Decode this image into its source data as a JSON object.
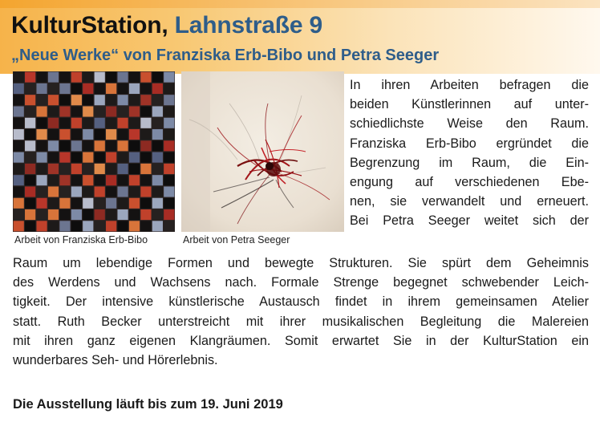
{
  "header": {
    "title_bold": "KulturStation,",
    "title_place": "Lahnstraße 9",
    "subtitle": "„Neue Werke“ von Franziska Erb-Bibo und Petra Seeger"
  },
  "images": [
    {
      "caption": "Arbeit von Franziska Erb-Bibo"
    },
    {
      "caption": "Arbeit von Petra Seeger"
    }
  ],
  "body": {
    "column_lines": [
      "In ihren Arbeiten befragen die",
      "beiden Künstlerinnen auf unter-",
      "schiedlichste Weise den Raum.",
      "Franziska Erb-Bibo ergründet die",
      "Begrenzung im Raum, die Ein-",
      "engung auf verschiedenen Ebe-",
      "nen, sie verwandelt und erneuert.",
      "Bei Petra Seeger weitet sich der"
    ],
    "full_lines": [
      "Raum um lebendige Formen und bewegte Strukturen. Sie spürt dem Geheimnis",
      "des Werdens und Wachsens nach. Formale Strenge begegnet schwebender Leich-",
      "tigkeit. Der intensive künstlerische Austausch findet in ihrem gemeinsamen Atelier",
      "statt. Ruth Becker unterstreicht mit ihrer musikalischen Begleitung die Malereien",
      "mit ihren ganz eigenen Klangräumen. Somit erwartet Sie in der KulturStation ein",
      "wunderbares Seh- und Hörerlebnis."
    ]
  },
  "footer": {
    "note": "Die Ausstellung läuft bis zum 19. Juni 2019"
  },
  "colors": {
    "accent_blue": "#2e5d8a",
    "header_orange": "#f6b34a"
  }
}
